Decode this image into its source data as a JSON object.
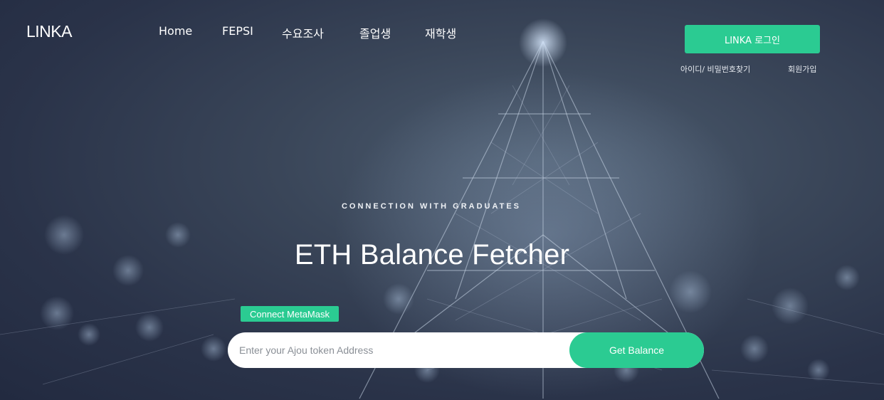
{
  "brand": {
    "logo": "LINKA"
  },
  "nav": {
    "items": [
      {
        "label": "Home"
      },
      {
        "label": "FEPSI"
      },
      {
        "label": "수요조사"
      },
      {
        "label": "졸업생"
      },
      {
        "label": "재학생"
      }
    ]
  },
  "auth": {
    "login_label": "LINKA 로그인",
    "find_account": "아이디/ 비밀번호찾기",
    "signup": "회원가입"
  },
  "hero": {
    "eyebrow": "CONNECTION WITH GRADUATES",
    "title": "ETH Balance Fetcher",
    "connect_label": "Connect MetaMask",
    "address_placeholder": "Enter your Ajou token Address",
    "submit_label": "Get Balance"
  },
  "colors": {
    "accent": "#2bcb92",
    "background": "#2a3349"
  },
  "icons": {
    "background": "ethereum-network-illustration"
  }
}
